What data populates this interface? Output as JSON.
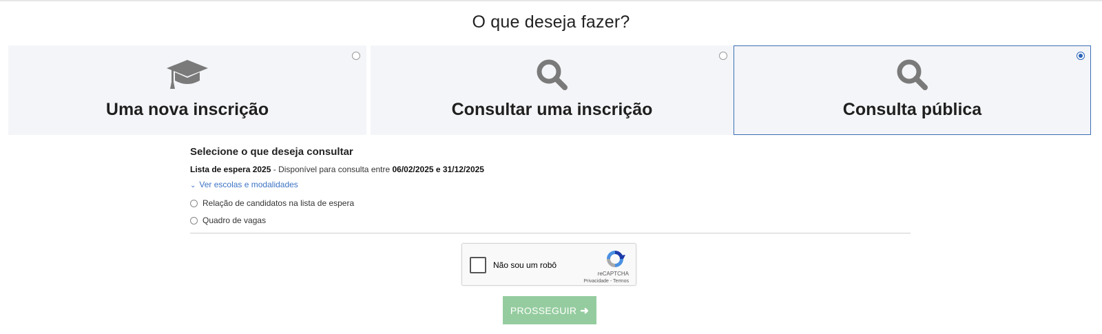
{
  "page": {
    "title": "O que deseja fazer?"
  },
  "cards": [
    {
      "label": "Uma nova inscrição",
      "icon": "graduation-cap-icon",
      "selected": false
    },
    {
      "label": "Consultar uma inscrição",
      "icon": "search-icon",
      "selected": false
    },
    {
      "label": "Consulta pública",
      "icon": "search-icon",
      "selected": true
    }
  ],
  "consult": {
    "title": "Selecione o que deseja consultar",
    "list_name": "Lista de espera 2025",
    "availability_text": " - Disponível para consulta entre ",
    "date_start": "06/02/2025",
    "date_sep": " e ",
    "date_end": "31/12/2025",
    "toggle_label": "Ver escolas e modalidades",
    "options": [
      {
        "label": "Relação de candidatos na lista de espera",
        "selected": false
      },
      {
        "label": "Quadro de vagas",
        "selected": false
      }
    ]
  },
  "captcha": {
    "label": "Não sou um robô",
    "brand": "reCAPTCHA",
    "privacy": "Privacidade",
    "separator": " - ",
    "terms": "Termos"
  },
  "submit": {
    "label": "PROSSEGUIR",
    "disabled": true
  },
  "colors": {
    "accent": "#3b6fb6",
    "card_bg": "#f4f5f8",
    "submit_bg": "#95cc9f",
    "link": "#3c72c4"
  }
}
